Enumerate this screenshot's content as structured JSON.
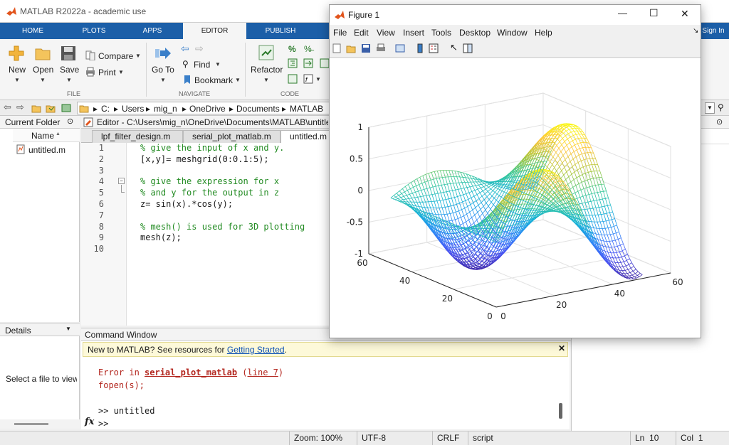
{
  "app": {
    "title": "MATLAB R2022a - academic use"
  },
  "ribbon_tabs": [
    "HOME",
    "PLOTS",
    "APPS",
    "EDITOR",
    "PUBLISH",
    "Sign In"
  ],
  "ribbon": {
    "new": "New",
    "open": "Open",
    "save": "Save",
    "compare": "Compare",
    "print": "Print",
    "file_group": "FILE",
    "go_to": "Go To",
    "find": "Find",
    "bookmark": "Bookmark",
    "navigate_group": "NAVIGATE",
    "refactor": "Refactor",
    "code_group": "CODE"
  },
  "address": {
    "path": [
      "C:",
      "Users",
      "mig_n",
      "OneDrive",
      "Documents",
      "MATLAB"
    ]
  },
  "current_folder": {
    "title": "Current Folder",
    "column": "Name",
    "sort_arrow": "▲",
    "files": [
      "untitled.m"
    ]
  },
  "details": {
    "title": "Details",
    "message": "Select a file to view d"
  },
  "editor": {
    "title": "Editor - C:\\Users\\mig_n\\OneDrive\\Documents\\MATLAB\\untitled.m",
    "tabs": [
      "lpf_filter_design.m",
      "serial_plot_matlab.m",
      "untitled.m"
    ],
    "lines": [
      {
        "n": "1",
        "text": "% give the input of x and y.",
        "comment": true
      },
      {
        "n": "2",
        "text": "[x,y]= meshgrid(0:0.1:5);",
        "comment": false
      },
      {
        "n": "3",
        "text": "",
        "comment": false
      },
      {
        "n": "4",
        "text": "% give the expression for x",
        "comment": true
      },
      {
        "n": "5",
        "text": "% and y for the output in z",
        "comment": true
      },
      {
        "n": "6",
        "text": "z= sin(x).*cos(y);",
        "comment": false
      },
      {
        "n": "7",
        "text": "",
        "comment": false
      },
      {
        "n": "8",
        "text": "% mesh() is used for 3D plotting",
        "comment": true
      },
      {
        "n": "9",
        "text": "mesh(z);",
        "comment": false
      },
      {
        "n": "10",
        "text": "",
        "comment": false
      }
    ]
  },
  "command_window": {
    "title": "Command Window",
    "banner_text": "New to MATLAB? See resources for ",
    "banner_link": "Getting Started",
    "banner_end": ".",
    "error_prefix": "Error in ",
    "error_fn": "serial_plot_matlab",
    "error_line": "line 7",
    "error_line2": "fopen(s);",
    "prompt1": ">> untitled",
    "prompt2": ">>",
    "fx": "fx"
  },
  "status": {
    "zoom": "Zoom: 100%",
    "encoding": "UTF-8",
    "eol": "CRLF",
    "type": "script",
    "ln_label": "Ln",
    "ln": "10",
    "col_label": "Col",
    "col": "1"
  },
  "figure": {
    "title": "Figure 1",
    "menus": [
      "File",
      "Edit",
      "View",
      "Insert",
      "Tools",
      "Desktop",
      "Window",
      "Help"
    ],
    "controls": {
      "minimize": "—",
      "maximize": "☐",
      "close": "✕"
    }
  },
  "chart_data": {
    "type": "mesh",
    "function": "z = sin(x).*cos(y)",
    "x_range": [
      0,
      51
    ],
    "y_range": [
      0,
      51
    ],
    "zlim": [
      -1,
      1
    ],
    "z_ticks": [
      "1",
      "0.5",
      "0",
      "-0.5",
      "-1"
    ],
    "x_ticks": [
      "0",
      "20",
      "40",
      "60"
    ],
    "y_ticks": [
      "0",
      "20",
      "40",
      "60"
    ],
    "colormap": "parula",
    "grid": true
  }
}
